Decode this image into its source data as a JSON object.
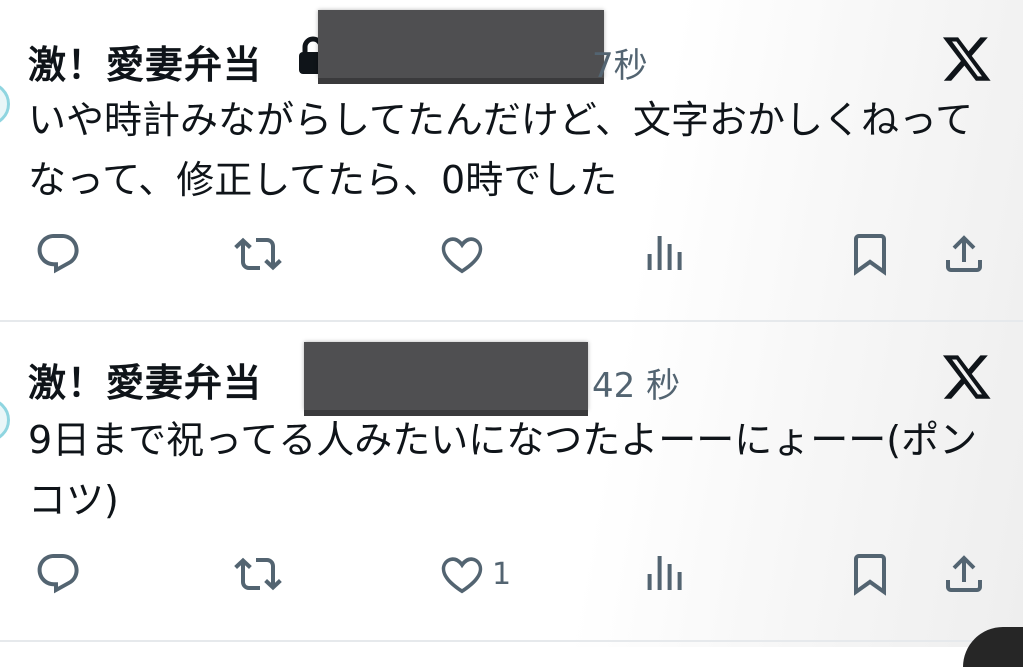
{
  "tweets": [
    {
      "author_name": "激！愛妻弁当",
      "partial_glyph": "7",
      "time": "秒",
      "body": "いや時計みながらしてたんだけど、文字おかしくねってなって、修正してたら、0時でした",
      "like_count": ""
    },
    {
      "author_name": "激！愛妻弁当",
      "partial_glyph": "",
      "time": "42 秒",
      "body": "9日まで祝ってる人みたいになつたよーーにょーー(ポンコツ)",
      "like_count": "1"
    }
  ],
  "icons": {
    "reply": "reply-icon",
    "repost": "repost-icon",
    "like": "heart-icon",
    "views": "views-icon",
    "bookmark": "bookmark-icon",
    "share": "share-icon",
    "x_logo": "x-logo-icon",
    "lock": "lock-icon"
  },
  "colors": {
    "text": "#0f1419",
    "muted": "#536471",
    "divider": "#e6e9ec",
    "redaction": "#4f4f51"
  }
}
